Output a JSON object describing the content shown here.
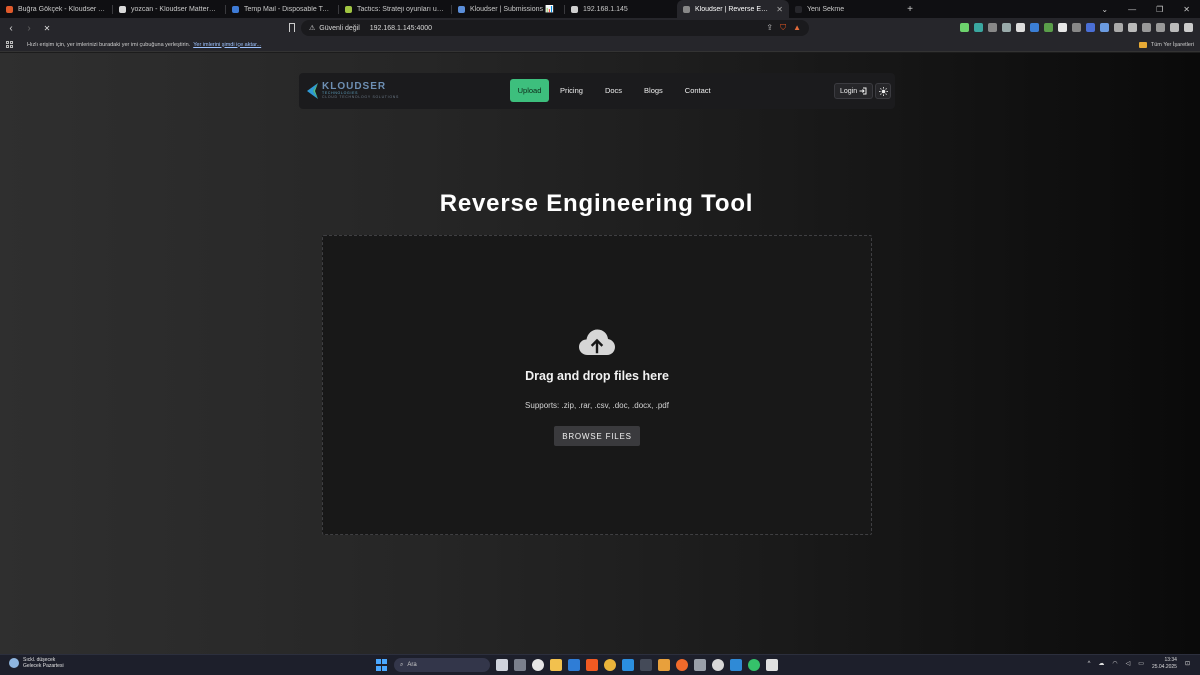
{
  "browser": {
    "tabs": [
      {
        "title": "Buğra Gökçek - Kloudser Technolog",
        "active": false,
        "favicon_color": "#e05a2b"
      },
      {
        "title": "yozcan - Kloudser Mattermost",
        "active": false,
        "favicon_color": "#d9d9d9"
      },
      {
        "title": "Temp Mail - Disposable Temporary",
        "active": false,
        "favicon_color": "#3e7bd6"
      },
      {
        "title": "Tactics: Strateji oyunları uygulaması",
        "active": false,
        "favicon_color": "#a0c542"
      },
      {
        "title": "Kloudser | Submissions 📊",
        "active": false,
        "favicon_color": "#5b8ed9"
      },
      {
        "title": "192.168.1.145",
        "active": false,
        "favicon_color": "#cfcfcf"
      },
      {
        "title": "Kloudser | Reverse Engineering",
        "active": true,
        "favicon_color": "#888888"
      },
      {
        "title": "Yeni Sekme",
        "active": false,
        "favicon_color": "#26262b"
      }
    ],
    "new_tab_label": "+",
    "window_controls": [
      "⌄",
      "—",
      "❐",
      "✕"
    ],
    "nav": {
      "back": "‹",
      "forward": "›",
      "reload": "✕"
    },
    "security_label": "Güvenli değil",
    "url": "192.168.1.145:4000",
    "bookmarks_prompt": "Hızlı erişim için, yer imlerinizi buradaki yer imi çubuğuna yerleştirin.",
    "bookmarks_link": "Yer imlerini şimdi içe aktar...",
    "all_bookmarks": "Tüm Yer İşaretleri"
  },
  "site": {
    "logo": {
      "name": "KLOUDSER",
      "sub": "TECHNOLOGIES",
      "tagline": "CLOUD TECHNOLOGY SOLUTIONS"
    },
    "menu": [
      {
        "label": "Upload",
        "active": true
      },
      {
        "label": "Pricing",
        "active": false
      },
      {
        "label": "Docs",
        "active": false
      },
      {
        "label": "Blogs",
        "active": false
      },
      {
        "label": "Contact",
        "active": false
      }
    ],
    "login_label": "Login",
    "accent_color": "#3dbf7d"
  },
  "main": {
    "title": "Reverse Engineering Tool",
    "dropzone": {
      "title": "Drag and drop files here",
      "supports": "Supports: .zip, .rar, .csv, .doc, .docx, .pdf",
      "browse_label": "BROWSE FILES"
    }
  },
  "taskbar": {
    "weather_line1": "Sıckl. düşecek",
    "weather_line2": "Gelecek Pazartesi",
    "search_placeholder": "Ara",
    "time": "13:34",
    "date": "25.04.2025"
  }
}
